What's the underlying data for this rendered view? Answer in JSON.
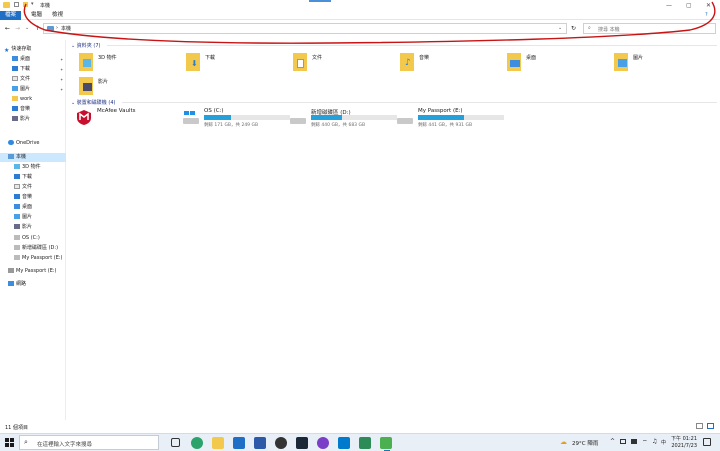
{
  "titlebar": {
    "title": "本機",
    "controls": [
      "—",
      "▢",
      "✕"
    ]
  },
  "ribbon": {
    "tabs": [
      "檔案",
      "電腦",
      "檢視"
    ],
    "help": "?"
  },
  "address": {
    "back": "←",
    "forward": "→",
    "recent": "⌄",
    "up": "↑",
    "path": "本機",
    "refresh": "↻",
    "search_placeholder": "搜尋 本機"
  },
  "sidebar": {
    "quick_access": "快速存取",
    "quick_items": [
      {
        "label": "桌面",
        "pinned": "✦"
      },
      {
        "label": "下載",
        "pinned": "✦"
      },
      {
        "label": "文件",
        "pinned": "✦"
      },
      {
        "label": "圖片",
        "pinned": "✦"
      },
      {
        "label": "work",
        "pinned": ""
      },
      {
        "label": "音樂",
        "pinned": ""
      },
      {
        "label": "影片",
        "pinned": ""
      }
    ],
    "onedrive": "OneDrive",
    "this_pc": "本機",
    "pc_items": [
      "3D 物件",
      "下載",
      "文件",
      "音樂",
      "桌面",
      "圖片",
      "影片",
      "OS (C:)",
      "新增磁碟區 (D:)",
      "My Passport (E:)"
    ],
    "my_passport": "My Passport (E:)",
    "network": "網路"
  },
  "folders_group": {
    "header": "資料夾 (7)",
    "items": [
      "3D 物件",
      "下載",
      "文件",
      "音樂",
      "桌面",
      "圖片",
      "影片"
    ]
  },
  "drives_group": {
    "header": "裝置和磁碟機 (4)",
    "mcafee": "McAfee Vaults",
    "drives": [
      {
        "name": "OS (C:)",
        "free": "剩餘 171 GB，共 249 GB",
        "used_fraction": 0.31
      },
      {
        "name": "新增磁碟區 (D:)",
        "free": "剩餘 440 GB，共 683 GB",
        "used_fraction": 0.36
      },
      {
        "name": "My Passport (E:)",
        "free": "剩餘 441 GB，共 931 GB",
        "used_fraction": 0.53
      }
    ]
  },
  "status": {
    "count": "11 個項目"
  },
  "taskbar": {
    "search_placeholder": "在這裡輸入文字來搜尋",
    "weather": "29°C 陣雨",
    "time": "下午 01:21",
    "date": "2021/7/23"
  },
  "colors": {
    "accent": "#1f6fc6",
    "drive_bar": "#26a0da",
    "folder": "#f3c94d",
    "annotation": "#c81414"
  }
}
